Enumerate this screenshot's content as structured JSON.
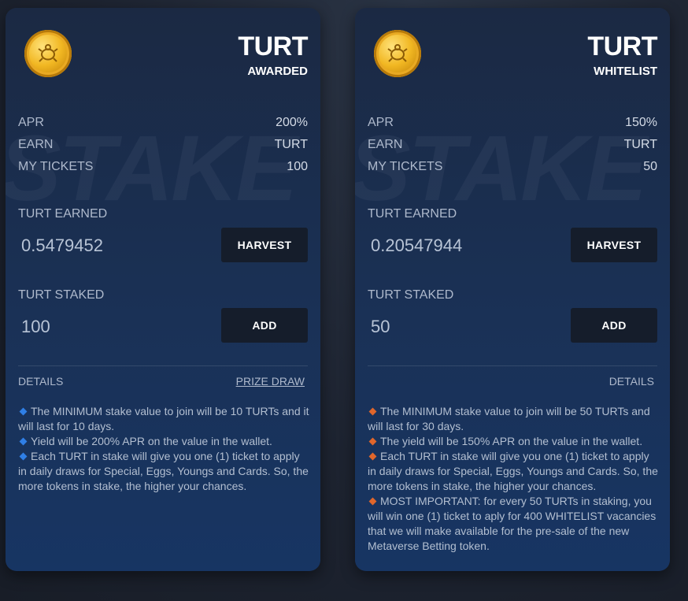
{
  "cards": [
    {
      "title": "TURT",
      "subtitle": "AWARDED",
      "watermark": "STAKE",
      "stats": [
        {
          "label": "APR",
          "value": "200%"
        },
        {
          "label": "EARN",
          "value": "TURT"
        },
        {
          "label": "MY TICKETS",
          "value": "100"
        }
      ],
      "earned_label": "TURT EARNED",
      "earned_value": "0.5479452",
      "harvest_label": "HARVEST",
      "staked_label": "TURT STAKED",
      "staked_value": "100",
      "add_label": "ADD",
      "details_label": "DETAILS",
      "prize_label": "PRIZE DRAW",
      "bullet_color": "#2f7fe6",
      "bullets": [
        "The MINIMUM stake value to join will be 10 TURTs and it will last for 10 days.",
        "Yield will be 200% APR on the value in the wallet.",
        "Each TURT in stake will give you one (1) ticket to apply in daily draws for Special, Eggs, Youngs and Cards. So, the more tokens in stake, the higher your chances."
      ]
    },
    {
      "title": "TURT",
      "subtitle": "WHITELIST",
      "watermark": "STAKE",
      "stats": [
        {
          "label": "APR",
          "value": "150%"
        },
        {
          "label": "EARN",
          "value": "TURT"
        },
        {
          "label": "MY TICKETS",
          "value": "50"
        }
      ],
      "earned_label": "TURT EARNED",
      "earned_value": "0.20547944",
      "harvest_label": "HARVEST",
      "staked_label": "TURT STAKED",
      "staked_value": "50",
      "add_label": "ADD",
      "details_label": "DETAILS",
      "bullet_color": "#e0662b",
      "bullets": [
        "The MINIMUM stake value to join will be 50 TURTs and will last for 30 days.",
        "The yield will be 150% APR on the value in the wallet.",
        "Each TURT in stake will give you one (1) ticket to apply in daily draws for Special, Eggs, Youngs and Cards. So, the more tokens in stake, the higher your chances.",
        "MOST IMPORTANT: for every 50 TURTs in staking, you will win one (1) ticket to aply for 400 WHITELIST vacancies that we will make available for the pre-sale of the new Metaverse Betting token."
      ]
    }
  ]
}
